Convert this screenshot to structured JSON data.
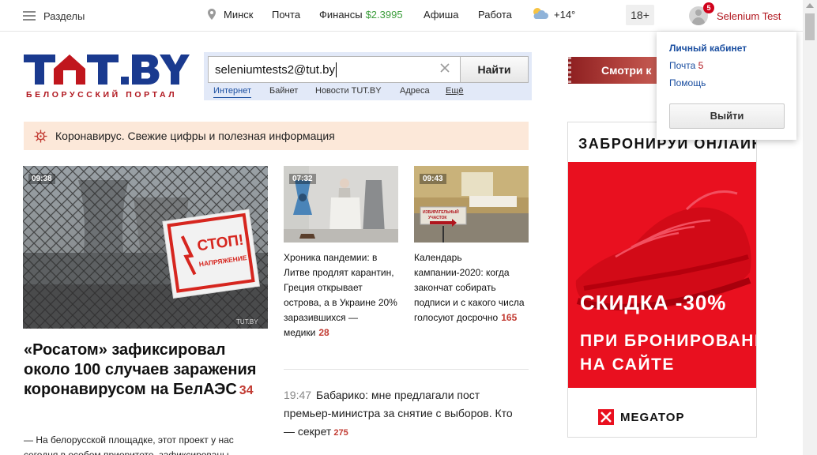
{
  "topbar": {
    "sections_label": "Разделы",
    "city": "Минск",
    "mail": "Почта",
    "finance": "Финансы",
    "finance_rate": "$2.3995",
    "afisha": "Афиша",
    "rabota": "Работа",
    "temperature": "+14°",
    "age_label": "18+",
    "notifications": "5",
    "username": "Selenium Test"
  },
  "dropdown": {
    "cabinet": "Личный кабинет",
    "mail": "Почта",
    "mail_count": "5",
    "help": "Помощь",
    "logout": "Выйти"
  },
  "logo": {
    "subtitle": "БЕЛОРУССКИЙ ПОРТАЛ"
  },
  "search": {
    "value": "seleniumtests2@tut.by",
    "button": "Найти",
    "tabs": [
      "Интернет",
      "Байнет",
      "Новости TUT.BY",
      "Адреса",
      "Ещё"
    ]
  },
  "promo": {
    "label": "Смотри к"
  },
  "corona_banner": {
    "text": "Коронавирус. Свежие цифры и полезная информация"
  },
  "news": {
    "main": {
      "time": "09:38",
      "title": "«Росатом» зафиксировал около 100 случаев заражения коронавирусом на БелАЭС",
      "count": "34",
      "lead": "— На белорусской площадке, этот проект у нас сегодня в особом приоритете, зафиксированы",
      "sign_text": "СТОП! НАПРЯЖЕНИЕ",
      "watermark": "TUT.BY"
    },
    "second": {
      "time": "07:32",
      "title": "Хроника пандемии: в Литве продлят карантин, Греция открывает острова, а в Украине 20% заразившихся — медики",
      "count": "28"
    },
    "third": {
      "time": "09:43",
      "title": "Календарь кампании-2020: когда закончат собирать подписи и с какого числа голосуют досрочно",
      "count": "165",
      "sign_text": "ИЗБИРАТЕЛЬНЫЙ УЧАСТОК"
    },
    "feed": {
      "time": "19:47",
      "title": "Бабарико: мне предлагали пост премьер-министра за снятие с выборов. Кто — секрет",
      "count": "275"
    }
  },
  "ad": {
    "top_text": "ЗАБРОНИРУЙ ОНЛАЙН",
    "discount": "СКИДКА -30%",
    "line2": "ПРИ БРОНИРОВАНИИ",
    "line3": "НА САЙТЕ",
    "brand": "MEGATOP"
  },
  "colors": {
    "brand_blue": "#1a3a8f",
    "brand_red": "#b0151d",
    "link_blue": "#1a4ea0",
    "count_red": "#c23b32",
    "rate_green": "#3c9e3c",
    "ad_red": "#e9101f"
  },
  "icons": {
    "menu": "hamburger-icon",
    "location": "map-pin-icon",
    "weather": "sun-cloud-icon",
    "clear": "close-icon",
    "virus": "virus-icon"
  }
}
